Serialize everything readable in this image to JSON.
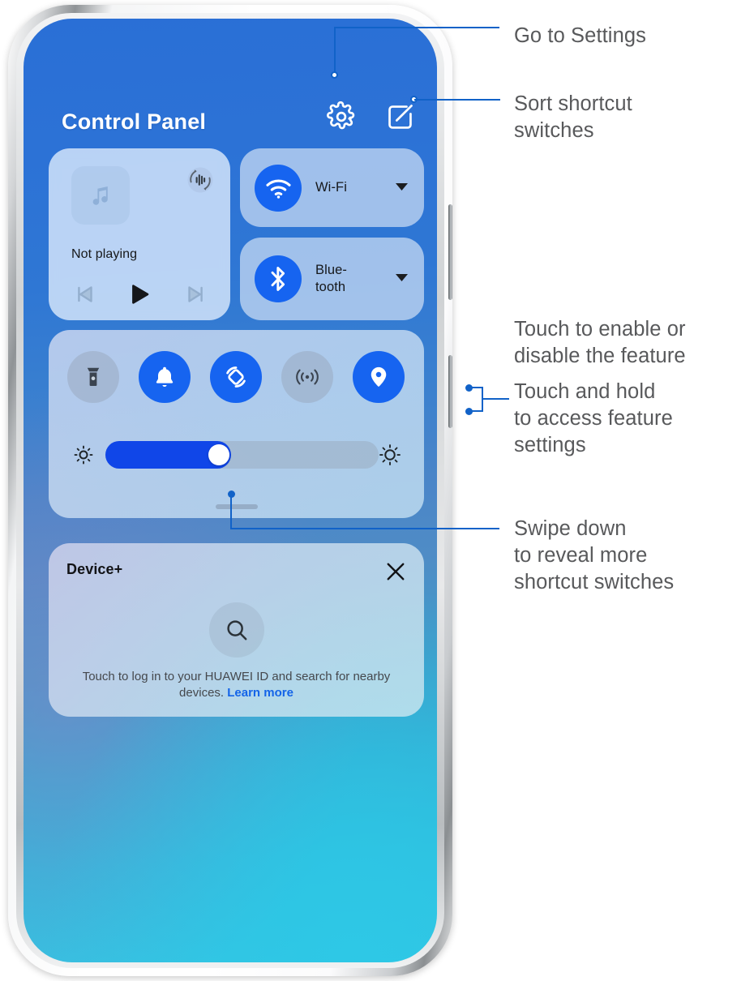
{
  "panel": {
    "title": "Control Panel",
    "header_icons": [
      {
        "name": "gear-icon",
        "label": "Settings"
      },
      {
        "name": "edit-icon",
        "label": "Sort shortcut switches"
      }
    ]
  },
  "media": {
    "status": "Not playing",
    "album_icon": "music-note-icon",
    "cast_icon": "audio-cast-icon",
    "controls": [
      {
        "name": "previous-track-button",
        "state": "inactive"
      },
      {
        "name": "play-button",
        "state": "active"
      },
      {
        "name": "next-track-button",
        "state": "inactive"
      }
    ]
  },
  "network_tiles": [
    {
      "name": "wifi-tile",
      "label": "Wi-Fi",
      "icon": "wifi-icon",
      "state": "on",
      "expand": "caret-down-icon"
    },
    {
      "name": "bluetooth-tile",
      "label": "Blue-\ntooth",
      "label_line1": "Blue-",
      "label_line2": "tooth",
      "icon": "bluetooth-icon",
      "state": "on",
      "expand": "caret-down-icon"
    }
  ],
  "shortcuts": [
    {
      "name": "flashlight-toggle",
      "icon": "flashlight-icon",
      "state": "off"
    },
    {
      "name": "ring-toggle",
      "icon": "bell-icon",
      "state": "on"
    },
    {
      "name": "auto-rotate-toggle",
      "icon": "auto-rotate-icon",
      "state": "on"
    },
    {
      "name": "hotspot-toggle",
      "icon": "hotspot-icon",
      "state": "off"
    },
    {
      "name": "location-toggle",
      "icon": "location-pin-icon",
      "state": "on"
    }
  ],
  "brightness": {
    "name": "brightness-slider",
    "low_icon": "brightness-low-icon",
    "high_icon": "brightness-high-icon",
    "value_percent": 46
  },
  "drag_handle": {
    "name": "panel-drag-handle"
  },
  "device_plus": {
    "title": "Device+",
    "close_icon": "close-icon",
    "search_icon": "search-icon",
    "description": "Touch to log in to your HUAWEI ID and search for nearby devices.",
    "link_text": "Learn more"
  },
  "annotations": [
    {
      "name": "annotation-go-to-settings",
      "text": "Go to Settings"
    },
    {
      "name": "annotation-sort-shortcut-switches",
      "line1": "Sort shortcut",
      "line2": "switches"
    },
    {
      "name": "annotation-touch-to-enable",
      "line1": "Touch to enable or",
      "line2": "disable the feature"
    },
    {
      "name": "annotation-touch-and-hold",
      "line1": "Touch and hold",
      "line2": "to access feature",
      "line3": "settings"
    },
    {
      "name": "annotation-swipe-down",
      "line1": "Swipe down",
      "line2": "to reveal more",
      "line3": "shortcut switches"
    }
  ],
  "colors": {
    "accent_blue": "#1664f0",
    "leader_blue": "#1162c8",
    "annotation_text": "#58595b",
    "link_blue": "#1464e8"
  }
}
